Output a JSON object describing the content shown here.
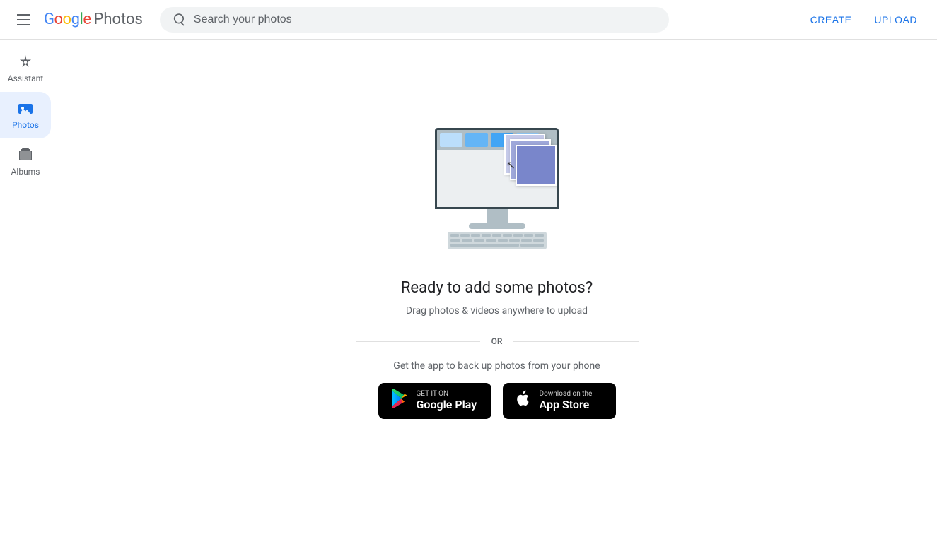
{
  "app": {
    "name": "Google Photos"
  },
  "header": {
    "menu_label": "Menu",
    "search_placeholder": "Search your photos",
    "create_label": "CREATE",
    "upload_label": "UPLOAD"
  },
  "sidebar": {
    "items": [
      {
        "id": "assistant",
        "label": "Assistant",
        "active": false
      },
      {
        "id": "photos",
        "label": "Photos",
        "active": true
      },
      {
        "id": "albums",
        "label": "Albums",
        "active": false
      }
    ]
  },
  "main": {
    "empty_state": {
      "title": "Ready to add some photos?",
      "subtitle": "Drag photos & videos anywhere to upload",
      "or_text": "OR",
      "app_desc": "Get the app to back up photos from your phone",
      "google_play": {
        "pre_text": "GET IT ON",
        "name": "Google Play"
      },
      "app_store": {
        "pre_text": "Download on the",
        "name": "App Store"
      }
    }
  }
}
